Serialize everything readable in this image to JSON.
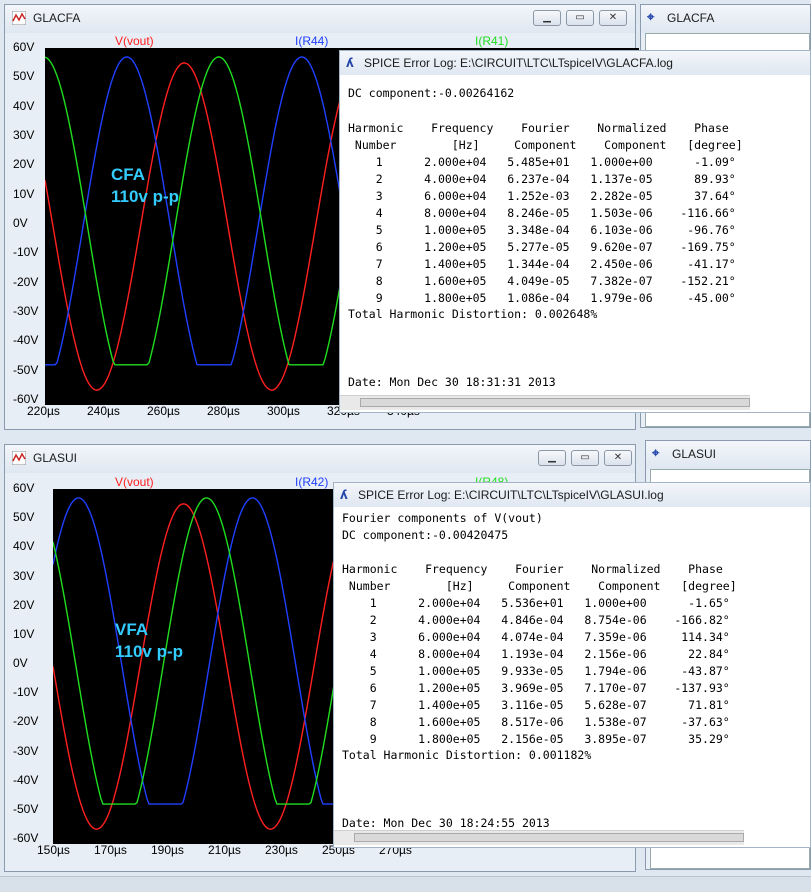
{
  "top_window": {
    "title": "GLACFA",
    "trace_labels": [
      {
        "text": "V(vout)",
        "color": "#ff2020"
      },
      {
        "text": "I(R44)",
        "color": "#2040ff"
      },
      {
        "text": "I(R41)",
        "color": "#20dd20"
      }
    ],
    "y_ticks": [
      "60V",
      "50V",
      "40V",
      "30V",
      "20V",
      "10V",
      "0V",
      "-10V",
      "-20V",
      "-30V",
      "-40V",
      "-50V",
      "-60V"
    ],
    "x_ticks": [
      "220µs",
      "240µs",
      "260µs",
      "280µs",
      "300µs",
      "320µs",
      "340µs"
    ],
    "overlay_line1": "CFA",
    "overlay_line2": "110v p-p"
  },
  "top_log": {
    "title": "SPICE Error Log: E:\\CIRCUIT\\LTC\\LTspiceIV\\GLACFA.log",
    "dc_component": "DC component:-0.00264162",
    "header1": "Harmonic    Frequency    Fourier    Normalized    Phase",
    "header2": " Number        [Hz]     Component    Component   [degree]",
    "rows": [
      "    1      2.000e+04   5.485e+01   1.000e+00      -1.09°",
      "    2      4.000e+04   6.237e-04   1.137e-05      89.93°",
      "    3      6.000e+04   1.252e-03   2.282e-05      37.64°",
      "    4      8.000e+04   8.246e-05   1.503e-06    -116.66°",
      "    5      1.000e+05   3.348e-04   6.103e-06     -96.76°",
      "    6      1.200e+05   5.277e-05   9.620e-07    -169.75°",
      "    7      1.400e+05   1.344e-04   2.450e-06     -41.17°",
      "    8      1.600e+05   4.049e-05   7.382e-07    -152.21°",
      "    9      1.800e+05   1.086e-04   1.979e-06     -45.00°"
    ],
    "thd": "Total Harmonic Distortion: 0.002648%",
    "date": "Date: Mon Dec 30 18:31:31 2013"
  },
  "bottom_window": {
    "title": "GLASUI",
    "trace_labels": [
      {
        "text": "V(vout)",
        "color": "#ff2020"
      },
      {
        "text": "I(R42)",
        "color": "#2040ff"
      },
      {
        "text": "I(R48)",
        "color": "#20dd20"
      }
    ],
    "y_ticks": [
      "60V",
      "50V",
      "40V",
      "30V",
      "20V",
      "10V",
      "0V",
      "-10V",
      "-20V",
      "-30V",
      "-40V",
      "-50V",
      "-60V"
    ],
    "x_ticks": [
      "150µs",
      "170µs",
      "190µs",
      "210µs",
      "230µs",
      "250µs",
      "270µs"
    ],
    "overlay_line1": "VFA",
    "overlay_line2": "110v p-p"
  },
  "bottom_log": {
    "title": "SPICE Error Log: E:\\CIRCUIT\\LTC\\LTspiceIV\\GLASUI.log",
    "fourier_line": "Fourier components of V(vout)",
    "dc_component": "DC component:-0.00420475",
    "header1": "Harmonic    Frequency    Fourier    Normalized    Phase",
    "header2": " Number        [Hz]     Component    Component   [degree]",
    "rows": [
      "    1      2.000e+04   5.536e+01   1.000e+00      -1.65°",
      "    2      4.000e+04   4.846e-04   8.754e-06    -166.82°",
      "    3      6.000e+04   4.074e-04   7.359e-06     114.34°",
      "    4      8.000e+04   1.193e-04   2.156e-06      22.84°",
      "    5      1.000e+05   9.933e-05   1.794e-06     -43.87°",
      "    6      1.200e+05   3.969e-05   7.170e-07    -137.93°",
      "    7      1.400e+05   3.116e-05   5.628e-07      71.81°",
      "    8      1.600e+05   8.517e-06   1.538e-07     -37.63°",
      "    9      1.800e+05   2.156e-05   3.895e-07      35.29°"
    ],
    "thd": "Total Harmonic Distortion: 0.001182%",
    "date": "Date: Mon Dec 30 18:24:55 2013"
  },
  "side_top": {
    "title": "GLACFA"
  },
  "side_bottom": {
    "title": "GLASUI"
  }
}
